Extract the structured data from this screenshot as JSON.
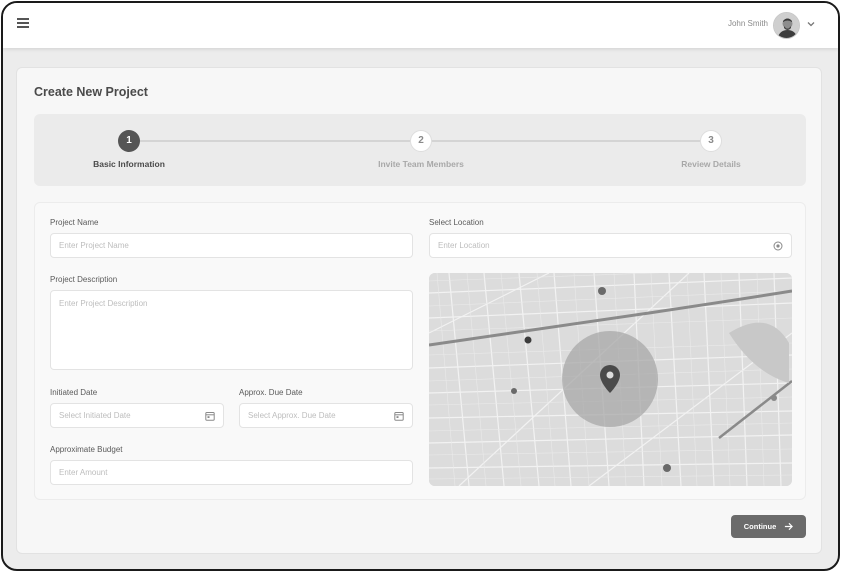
{
  "header": {
    "user_name": "John Smith",
    "icons": [
      "menu-icon",
      "avatar",
      "chevron-down-icon"
    ]
  },
  "page": {
    "title": "Create New Project"
  },
  "stepper": {
    "steps": [
      {
        "number": "1",
        "label": "Basic Information",
        "state": "active"
      },
      {
        "number": "2",
        "label": "Invite Team Members",
        "state": "pending"
      },
      {
        "number": "3",
        "label": "Review Details",
        "state": "pending"
      }
    ]
  },
  "form": {
    "project_name": {
      "label": "Project Name",
      "placeholder": "Enter Project Name",
      "value": ""
    },
    "project_description": {
      "label": "Project Description",
      "placeholder": "Enter Project Description",
      "value": ""
    },
    "initiated_date": {
      "label": "Initiated Date",
      "placeholder": "Select Initiated Date",
      "value": ""
    },
    "due_date": {
      "label": "Approx. Due Date",
      "placeholder": "Select Approx. Due Date",
      "value": ""
    },
    "budget": {
      "label": "Approximate Budget",
      "placeholder": "Enter Amount",
      "value": ""
    },
    "location": {
      "label": "Select Location",
      "placeholder": "Enter Location",
      "value": ""
    }
  },
  "actions": {
    "continue_label": "Continue"
  },
  "colors": {
    "accent": "#555555",
    "button": "#6b6b6b",
    "background": "#ececec"
  }
}
